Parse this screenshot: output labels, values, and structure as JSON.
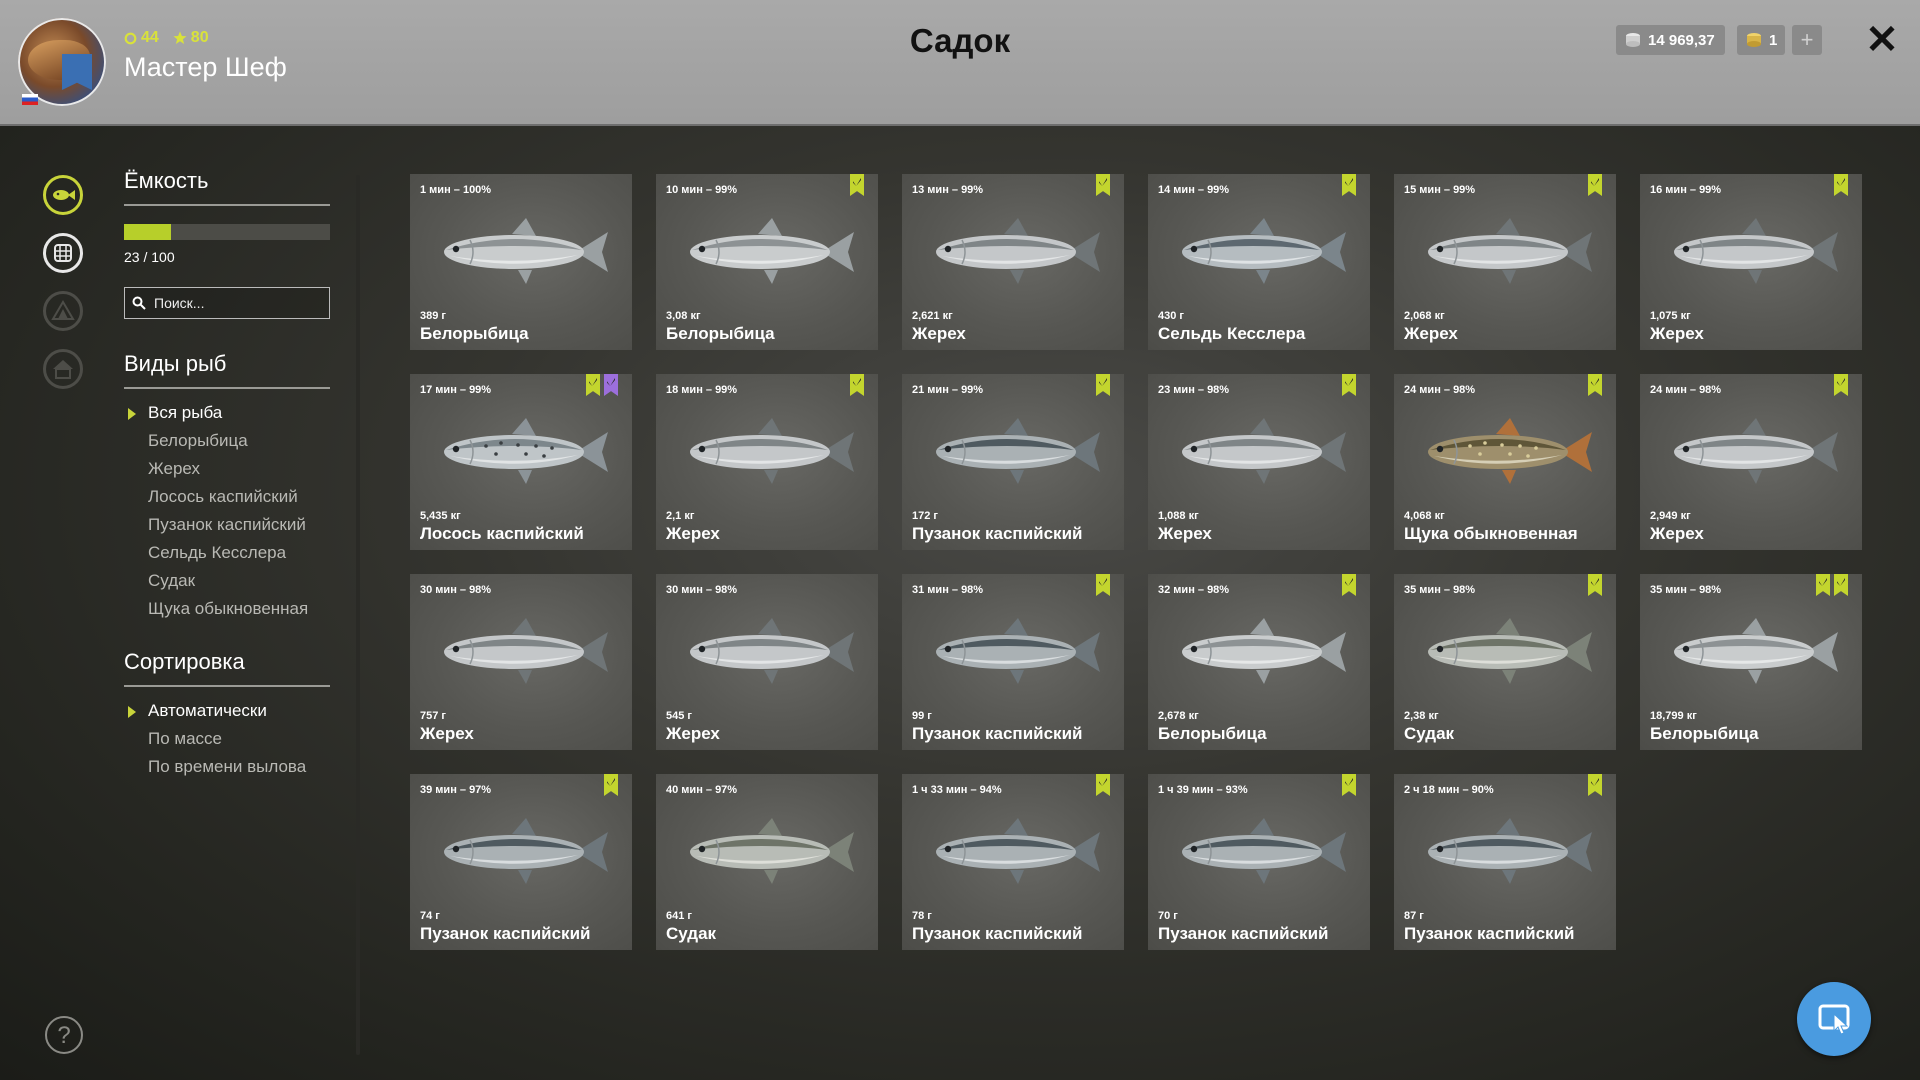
{
  "header": {
    "title": "Садок",
    "player_name": "Мастер Шеф",
    "stat_a": "44",
    "stat_b": "80",
    "money": "14 969,37",
    "gold": "1",
    "plus": "+",
    "close": "✕"
  },
  "colors": {
    "accent": "#c3d52e",
    "header_bg": "#a9a9a9",
    "card_bg": "#5a5a56",
    "purple_tag": "#9c6fdc",
    "fab": "#4a9be0"
  },
  "capacity": {
    "title": "Ёмкость",
    "text": "23 / 100",
    "fraction": 0.23
  },
  "search": {
    "placeholder": "Поиск..."
  },
  "species": {
    "title": "Виды рыб",
    "items": [
      "Вся рыба",
      "Белорыбица",
      "Жерех",
      "Лосось каспийский",
      "Пузанок каспийский",
      "Сельдь Кесслера",
      "Судак",
      "Щука обыкновенная"
    ],
    "selected": 0
  },
  "sorting": {
    "title": "Сортировка",
    "items": [
      "Автоматически",
      "По массе",
      "По времени вылова"
    ],
    "selected": 0
  },
  "help": "?",
  "rail_icons": [
    "fish-icon",
    "keepnet-icon",
    "camp-icon",
    "home-icon"
  ],
  "catches": [
    {
      "time": "1 мин – 100%",
      "weight": "389 г",
      "name": "Белорыбица",
      "tags": [],
      "fish": "whitefish"
    },
    {
      "time": "10 мин – 99%",
      "weight": "3,08 кг",
      "name": "Белорыбица",
      "tags": [
        "green"
      ],
      "fish": "whitefish"
    },
    {
      "time": "13 мин – 99%",
      "weight": "2,621 кг",
      "name": "Жерех",
      "tags": [
        "green"
      ],
      "fish": "asp"
    },
    {
      "time": "14 мин – 99%",
      "weight": "430 г",
      "name": "Сельдь Кесслера",
      "tags": [
        "green"
      ],
      "fish": "herring"
    },
    {
      "time": "15 мин – 99%",
      "weight": "2,068 кг",
      "name": "Жерех",
      "tags": [
        "green"
      ],
      "fish": "asp"
    },
    {
      "time": "16 мин – 99%",
      "weight": "1,075 кг",
      "name": "Жерех",
      "tags": [
        "green"
      ],
      "fish": "asp"
    },
    {
      "time": "17 мин – 99%",
      "weight": "5,435 кг",
      "name": "Лосось каспийский",
      "tags": [
        "green",
        "purple"
      ],
      "fish": "salmon"
    },
    {
      "time": "18 мин – 99%",
      "weight": "2,1 кг",
      "name": "Жерех",
      "tags": [
        "green"
      ],
      "fish": "asp"
    },
    {
      "time": "21 мин – 99%",
      "weight": "172 г",
      "name": "Пузанок каспийский",
      "tags": [
        "green"
      ],
      "fish": "shad"
    },
    {
      "time": "23 мин – 98%",
      "weight": "1,088 кг",
      "name": "Жерех",
      "tags": [
        "green"
      ],
      "fish": "asp"
    },
    {
      "time": "24 мин – 98%",
      "weight": "4,068 кг",
      "name": "Щука обыкновенная",
      "tags": [
        "green"
      ],
      "fish": "pike"
    },
    {
      "time": "24 мин – 98%",
      "weight": "2,949 кг",
      "name": "Жерех",
      "tags": [
        "green"
      ],
      "fish": "asp"
    },
    {
      "time": "30 мин – 98%",
      "weight": "757 г",
      "name": "Жерех",
      "tags": [],
      "fish": "asp"
    },
    {
      "time": "30 мин – 98%",
      "weight": "545 г",
      "name": "Жерех",
      "tags": [],
      "fish": "asp"
    },
    {
      "time": "31 мин – 98%",
      "weight": "99 г",
      "name": "Пузанок каспийский",
      "tags": [
        "green"
      ],
      "fish": "shad"
    },
    {
      "time": "32 мин – 98%",
      "weight": "2,678 кг",
      "name": "Белорыбица",
      "tags": [
        "green"
      ],
      "fish": "whitefish"
    },
    {
      "time": "35 мин – 98%",
      "weight": "2,38 кг",
      "name": "Судак",
      "tags": [
        "green"
      ],
      "fish": "zander"
    },
    {
      "time": "35 мин – 98%",
      "weight": "18,799 кг",
      "name": "Белорыбица",
      "tags": [
        "green",
        "star"
      ],
      "fish": "whitefish"
    },
    {
      "time": "39 мин – 97%",
      "weight": "74 г",
      "name": "Пузанок каспийский",
      "tags": [
        "green"
      ],
      "fish": "shad"
    },
    {
      "time": "40 мин – 97%",
      "weight": "641 г",
      "name": "Судак",
      "tags": [],
      "fish": "zander"
    },
    {
      "time": "1 ч 33 мин – 94%",
      "weight": "78 г",
      "name": "Пузанок каспийский",
      "tags": [
        "green"
      ],
      "fish": "shad"
    },
    {
      "time": "1 ч 39 мин – 93%",
      "weight": "70 г",
      "name": "Пузанок каспийский",
      "tags": [
        "green"
      ],
      "fish": "shad"
    },
    {
      "time": "2 ч 18 мин – 90%",
      "weight": "87 г",
      "name": "Пузанок каспийский",
      "tags": [
        "green"
      ],
      "fish": "shad"
    }
  ]
}
